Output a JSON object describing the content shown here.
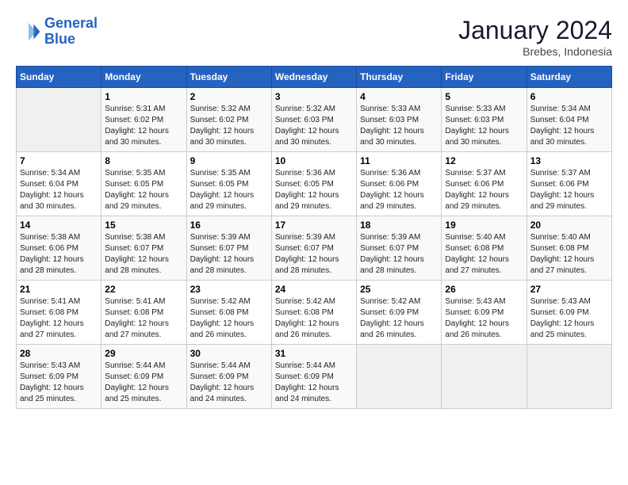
{
  "header": {
    "logo_line1": "General",
    "logo_line2": "Blue",
    "month_year": "January 2024",
    "location": "Brebes, Indonesia"
  },
  "weekdays": [
    "Sunday",
    "Monday",
    "Tuesday",
    "Wednesday",
    "Thursday",
    "Friday",
    "Saturday"
  ],
  "weeks": [
    [
      {
        "num": "",
        "info": ""
      },
      {
        "num": "1",
        "info": "Sunrise: 5:31 AM\nSunset: 6:02 PM\nDaylight: 12 hours\nand 30 minutes."
      },
      {
        "num": "2",
        "info": "Sunrise: 5:32 AM\nSunset: 6:02 PM\nDaylight: 12 hours\nand 30 minutes."
      },
      {
        "num": "3",
        "info": "Sunrise: 5:32 AM\nSunset: 6:03 PM\nDaylight: 12 hours\nand 30 minutes."
      },
      {
        "num": "4",
        "info": "Sunrise: 5:33 AM\nSunset: 6:03 PM\nDaylight: 12 hours\nand 30 minutes."
      },
      {
        "num": "5",
        "info": "Sunrise: 5:33 AM\nSunset: 6:03 PM\nDaylight: 12 hours\nand 30 minutes."
      },
      {
        "num": "6",
        "info": "Sunrise: 5:34 AM\nSunset: 6:04 PM\nDaylight: 12 hours\nand 30 minutes."
      }
    ],
    [
      {
        "num": "7",
        "info": "Sunrise: 5:34 AM\nSunset: 6:04 PM\nDaylight: 12 hours\nand 30 minutes."
      },
      {
        "num": "8",
        "info": "Sunrise: 5:35 AM\nSunset: 6:05 PM\nDaylight: 12 hours\nand 29 minutes."
      },
      {
        "num": "9",
        "info": "Sunrise: 5:35 AM\nSunset: 6:05 PM\nDaylight: 12 hours\nand 29 minutes."
      },
      {
        "num": "10",
        "info": "Sunrise: 5:36 AM\nSunset: 6:05 PM\nDaylight: 12 hours\nand 29 minutes."
      },
      {
        "num": "11",
        "info": "Sunrise: 5:36 AM\nSunset: 6:06 PM\nDaylight: 12 hours\nand 29 minutes."
      },
      {
        "num": "12",
        "info": "Sunrise: 5:37 AM\nSunset: 6:06 PM\nDaylight: 12 hours\nand 29 minutes."
      },
      {
        "num": "13",
        "info": "Sunrise: 5:37 AM\nSunset: 6:06 PM\nDaylight: 12 hours\nand 29 minutes."
      }
    ],
    [
      {
        "num": "14",
        "info": "Sunrise: 5:38 AM\nSunset: 6:06 PM\nDaylight: 12 hours\nand 28 minutes."
      },
      {
        "num": "15",
        "info": "Sunrise: 5:38 AM\nSunset: 6:07 PM\nDaylight: 12 hours\nand 28 minutes."
      },
      {
        "num": "16",
        "info": "Sunrise: 5:39 AM\nSunset: 6:07 PM\nDaylight: 12 hours\nand 28 minutes."
      },
      {
        "num": "17",
        "info": "Sunrise: 5:39 AM\nSunset: 6:07 PM\nDaylight: 12 hours\nand 28 minutes."
      },
      {
        "num": "18",
        "info": "Sunrise: 5:39 AM\nSunset: 6:07 PM\nDaylight: 12 hours\nand 28 minutes."
      },
      {
        "num": "19",
        "info": "Sunrise: 5:40 AM\nSunset: 6:08 PM\nDaylight: 12 hours\nand 27 minutes."
      },
      {
        "num": "20",
        "info": "Sunrise: 5:40 AM\nSunset: 6:08 PM\nDaylight: 12 hours\nand 27 minutes."
      }
    ],
    [
      {
        "num": "21",
        "info": "Sunrise: 5:41 AM\nSunset: 6:08 PM\nDaylight: 12 hours\nand 27 minutes."
      },
      {
        "num": "22",
        "info": "Sunrise: 5:41 AM\nSunset: 6:08 PM\nDaylight: 12 hours\nand 27 minutes."
      },
      {
        "num": "23",
        "info": "Sunrise: 5:42 AM\nSunset: 6:08 PM\nDaylight: 12 hours\nand 26 minutes."
      },
      {
        "num": "24",
        "info": "Sunrise: 5:42 AM\nSunset: 6:08 PM\nDaylight: 12 hours\nand 26 minutes."
      },
      {
        "num": "25",
        "info": "Sunrise: 5:42 AM\nSunset: 6:09 PM\nDaylight: 12 hours\nand 26 minutes."
      },
      {
        "num": "26",
        "info": "Sunrise: 5:43 AM\nSunset: 6:09 PM\nDaylight: 12 hours\nand 26 minutes."
      },
      {
        "num": "27",
        "info": "Sunrise: 5:43 AM\nSunset: 6:09 PM\nDaylight: 12 hours\nand 25 minutes."
      }
    ],
    [
      {
        "num": "28",
        "info": "Sunrise: 5:43 AM\nSunset: 6:09 PM\nDaylight: 12 hours\nand 25 minutes."
      },
      {
        "num": "29",
        "info": "Sunrise: 5:44 AM\nSunset: 6:09 PM\nDaylight: 12 hours\nand 25 minutes."
      },
      {
        "num": "30",
        "info": "Sunrise: 5:44 AM\nSunset: 6:09 PM\nDaylight: 12 hours\nand 24 minutes."
      },
      {
        "num": "31",
        "info": "Sunrise: 5:44 AM\nSunset: 6:09 PM\nDaylight: 12 hours\nand 24 minutes."
      },
      {
        "num": "",
        "info": ""
      },
      {
        "num": "",
        "info": ""
      },
      {
        "num": "",
        "info": ""
      }
    ]
  ]
}
